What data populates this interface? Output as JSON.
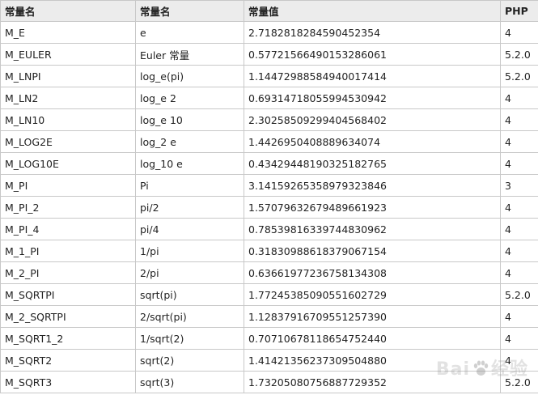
{
  "table": {
    "headers": [
      "常量名",
      "常量名",
      "常量值",
      "PHP"
    ],
    "rows": [
      [
        "M_E",
        "e",
        "2.7182818284590452354",
        "4"
      ],
      [
        "M_EULER",
        "Euler 常量",
        "0.57721566490153286061",
        "5.2.0"
      ],
      [
        "M_LNPI",
        "log_e(pi)",
        "1.14472988584940017414",
        "5.2.0"
      ],
      [
        "M_LN2",
        "log_e 2",
        "0.69314718055994530942",
        "4"
      ],
      [
        "M_LN10",
        "log_e 10",
        "2.30258509299404568402",
        "4"
      ],
      [
        "M_LOG2E",
        "log_2 e",
        "1.4426950408889634074",
        "4"
      ],
      [
        "M_LOG10E",
        "log_10 e",
        "0.43429448190325182765",
        "4"
      ],
      [
        "M_PI",
        "Pi",
        "3.14159265358979323846",
        "3"
      ],
      [
        "M_PI_2",
        "pi/2",
        "1.57079632679489661923",
        "4"
      ],
      [
        "M_PI_4",
        "pi/4",
        "0.78539816339744830962",
        "4"
      ],
      [
        "M_1_PI",
        "1/pi",
        "0.31830988618379067154",
        "4"
      ],
      [
        "M_2_PI",
        "2/pi",
        "0.63661977236758134308",
        "4"
      ],
      [
        "M_SQRTPI",
        "sqrt(pi)",
        "1.77245385090551602729",
        "5.2.0"
      ],
      [
        "M_2_SQRTPI",
        "2/sqrt(pi)",
        "1.12837916709551257390",
        "4"
      ],
      [
        "M_SQRT1_2",
        "1/sqrt(2)",
        "0.70710678118654752440",
        "4"
      ],
      [
        "M_SQRT2",
        "sqrt(2)",
        "1.41421356237309504880",
        "4"
      ],
      [
        "M_SQRT3",
        "sqrt(3)",
        "1.73205080756887729352",
        "5.2.0"
      ]
    ]
  },
  "watermark": {
    "text_left": "Bai",
    "text_right": "经验",
    "icon": "paw-icon"
  }
}
